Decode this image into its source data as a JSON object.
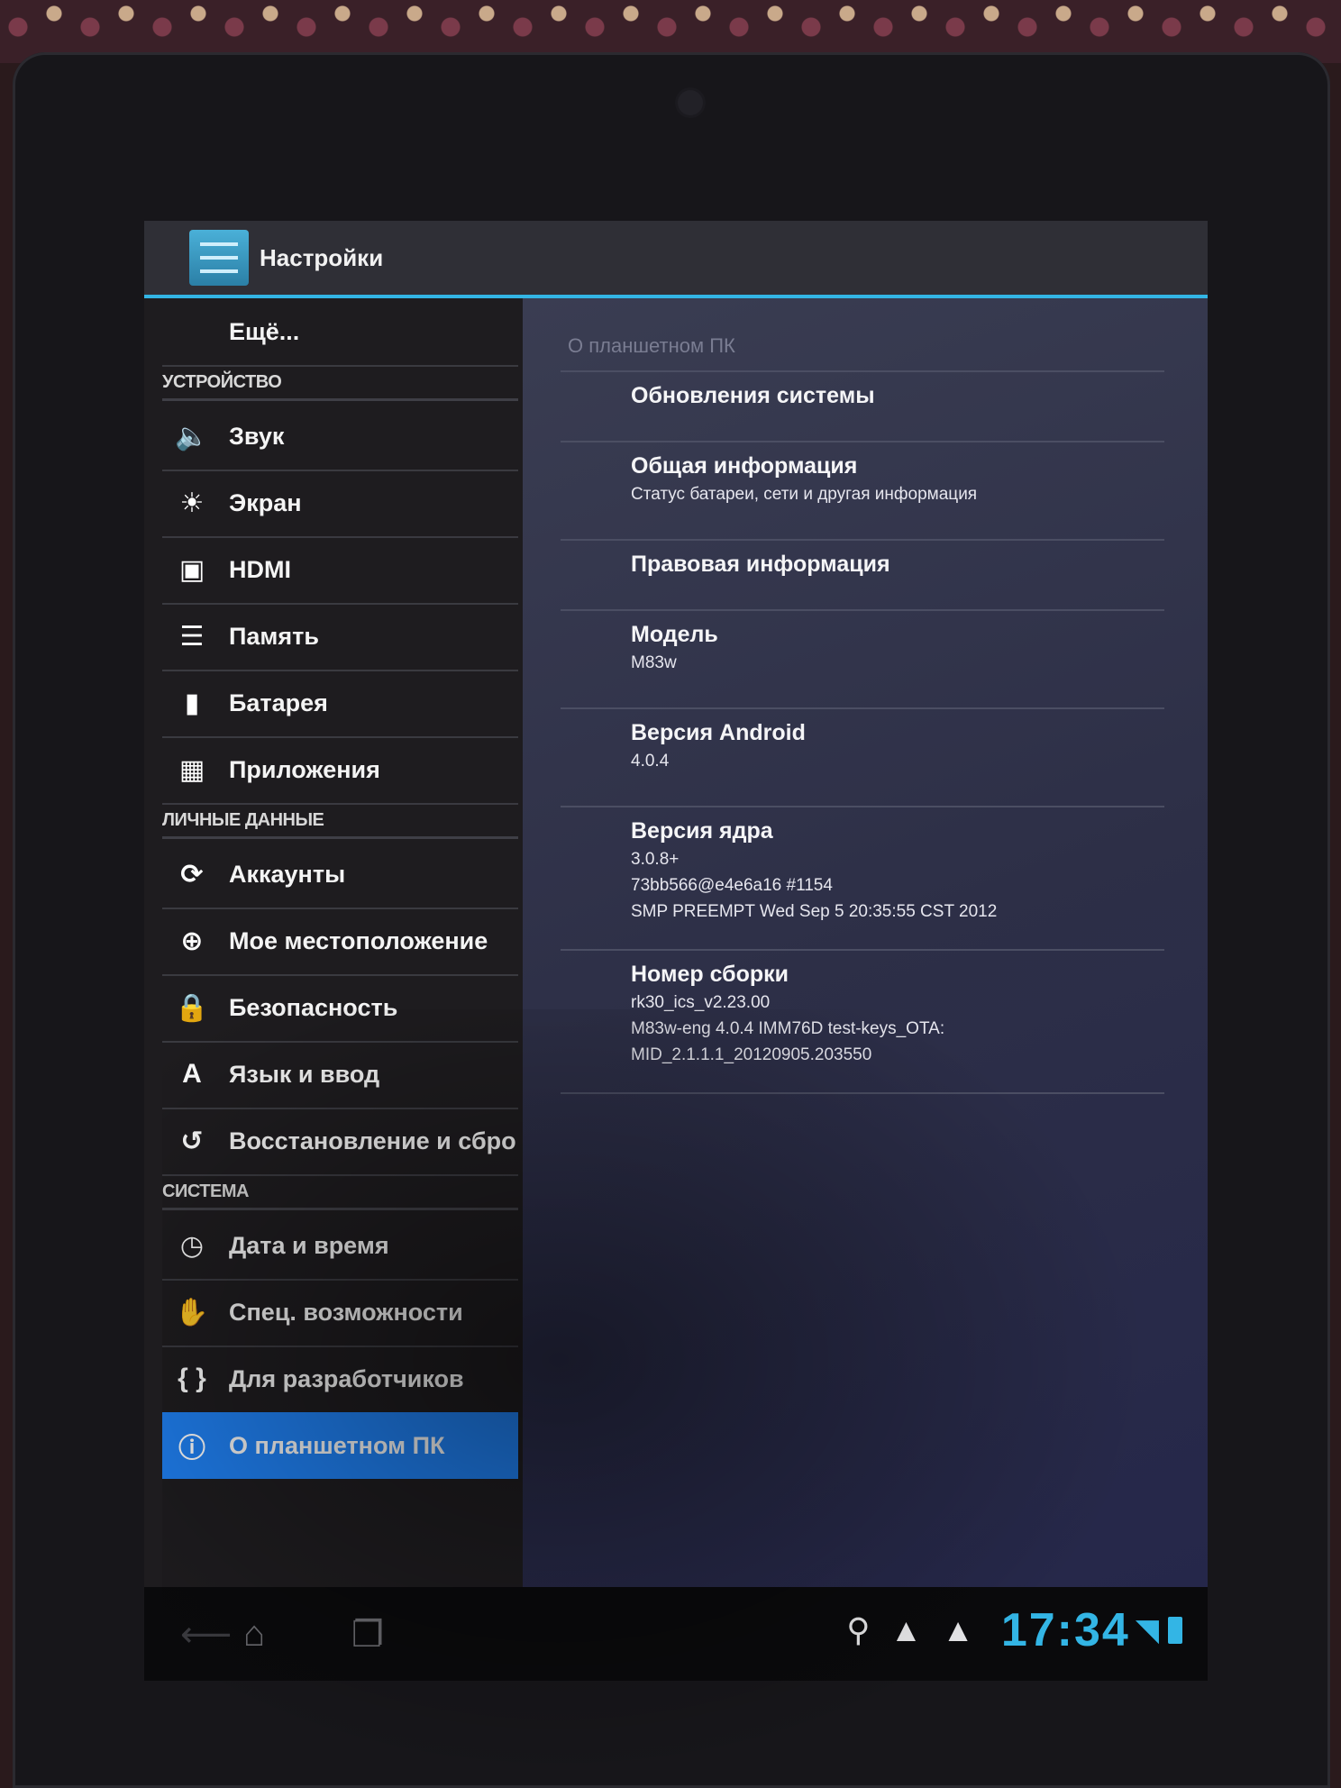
{
  "action_bar": {
    "title": "Настройки",
    "icon": "settings-sliders-icon"
  },
  "sidebar": {
    "items": [
      {
        "type": "item",
        "label": "Ещё...",
        "icon": ""
      },
      {
        "type": "section",
        "label": "УСТРОЙСТВО"
      },
      {
        "type": "item",
        "label": "Звук",
        "icon": "speaker-icon"
      },
      {
        "type": "item",
        "label": "Экран",
        "icon": "brightness-icon"
      },
      {
        "type": "item",
        "label": "HDMI",
        "icon": "hdmi-icon"
      },
      {
        "type": "item",
        "label": "Память",
        "icon": "storage-icon"
      },
      {
        "type": "item",
        "label": "Батарея",
        "icon": "battery-icon"
      },
      {
        "type": "item",
        "label": "Приложения",
        "icon": "apps-icon"
      },
      {
        "type": "section",
        "label": "ЛИЧНЫЕ ДАННЫЕ"
      },
      {
        "type": "item",
        "label": "Аккаунты",
        "icon": "sync-icon"
      },
      {
        "type": "item",
        "label": "Мое местоположение",
        "icon": "location-icon"
      },
      {
        "type": "item",
        "label": "Безопасность",
        "icon": "lock-icon"
      },
      {
        "type": "item",
        "label": "Язык и ввод",
        "icon": "language-icon"
      },
      {
        "type": "item",
        "label": "Восстановление и сбро",
        "icon": "restore-icon"
      },
      {
        "type": "section",
        "label": "СИСТЕМА"
      },
      {
        "type": "item",
        "label": "Дата и время",
        "icon": "clock-icon"
      },
      {
        "type": "item",
        "label": "Спец. возможности",
        "icon": "hand-icon"
      },
      {
        "type": "item",
        "label": "Для разработчиков",
        "icon": "braces-icon"
      },
      {
        "type": "item",
        "label": "О планшетном ПК",
        "icon": "info-icon",
        "selected": true
      }
    ]
  },
  "detail": {
    "title": "О планшетном ПК",
    "prefs": [
      {
        "title": "Обновления системы",
        "summary": []
      },
      {
        "title": "Общая информация",
        "summary": [
          "Статус батареи, сети и другая информация"
        ]
      },
      {
        "title": "Правовая информация",
        "summary": []
      },
      {
        "title": "Модель",
        "summary": [
          "M83w"
        ]
      },
      {
        "title": "Версия Android",
        "summary": [
          "4.0.4"
        ]
      },
      {
        "title": "Версия ядра",
        "summary": [
          "3.0.8+",
          "73bb566@e4e6a16 #1154",
          "SMP PREEMPT Wed Sep 5 20:35:55 CST 2012"
        ]
      },
      {
        "title": "Номер сборки",
        "summary": [
          "rk30_ics_v2.23.00",
          "M83w-eng 4.0.4 IMM76D test-keys_OTA:",
          "MID_2.1.1.1_20120905.203550"
        ]
      }
    ]
  },
  "navbar": {
    "buttons": [
      "back-icon",
      "home-icon",
      "recent-apps-icon"
    ],
    "status_icons": [
      "search-icon",
      "warning-icon",
      "warning-icon"
    ],
    "time": "17:34",
    "accent": "#33b5e5"
  }
}
